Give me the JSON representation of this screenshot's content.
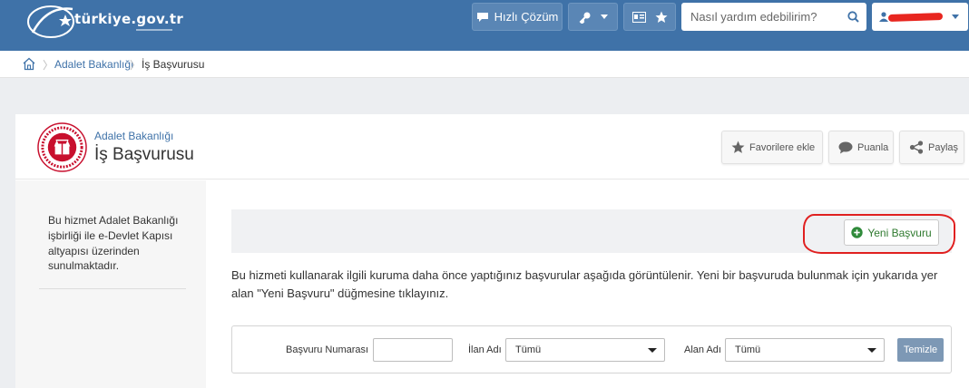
{
  "header": {
    "logo_text": "türkiye.gov.tr",
    "quick_solution_label": "Hızlı Çözüm",
    "search": {
      "placeholder": "Nasıl yardım edebilirim?",
      "value": ""
    },
    "colors": {
      "topbar": "#3f72a8",
      "redaction": "#e8261f"
    }
  },
  "breadcrumb": {
    "items": [
      "Adalet Bakanlığı",
      "İş Başvurusu"
    ]
  },
  "service": {
    "institution": "Adalet Bakanlığı",
    "title": "İş Başvurusu",
    "actions": {
      "favorite": "Favorilere ekle",
      "rate": "Puanla",
      "share": "Paylaş"
    }
  },
  "sidebar": {
    "note": "Bu hizmet Adalet Bakanlığı işbirliği ile e-Devlet Kapısı altyapısı üzerinden sunulmaktadır."
  },
  "main": {
    "new_application_label": "Yeni Başvuru",
    "description": "Bu hizmeti kullanarak ilgili kuruma daha önce yaptığınız başvurular aşağıda görüntülenir. Yeni bir başvuruda bulunmak için yukarıda yer alan \"Yeni Başvuru\" düğmesine tıklayınız.",
    "filters": {
      "application_number_label": "Başvuru Numarası",
      "application_number_value": "",
      "ad_name_label": "İlan Adı",
      "ad_name_selected": "Tümü",
      "field_name_label": "Alan Adı",
      "field_name_selected": "Tümü",
      "clear_label": "Temizle"
    }
  }
}
